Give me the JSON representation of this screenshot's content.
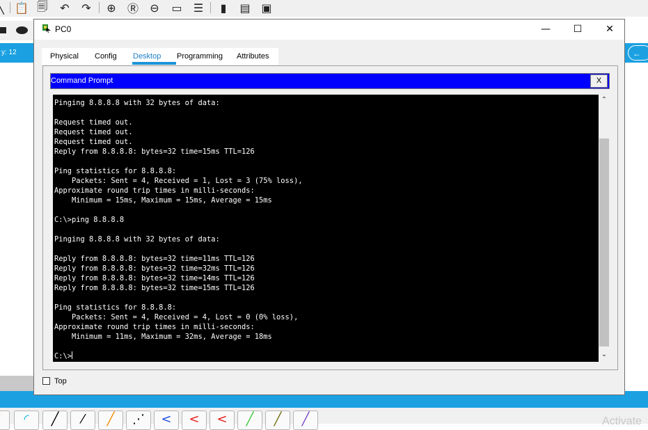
{
  "background_app": {
    "toolbar_icons": [
      "pointer-icon",
      "paste-icon",
      "copy-icon",
      "undo-icon",
      "redo-icon",
      "zoom-in-icon",
      "zoom-reset-icon",
      "zoom-out-icon",
      "rectangle-icon",
      "list-icon",
      "notes-icon",
      "drawing-palette-icon",
      "image-icon"
    ],
    "left_strip_text": "y: 12",
    "right_strip_text": "←",
    "device_palette_icons": [
      "bolt-icon",
      "curve-icon",
      "straight-line-icon",
      "dashed-line-icon",
      "orange-line-icon",
      "dotted-line-icon",
      "blue-angle-icon",
      "red-angle-icon",
      "red-angle2-icon",
      "green-line-icon",
      "olive-line-icon",
      "purple-line-icon"
    ],
    "watermark_text": "Activate"
  },
  "window": {
    "title": "PC0",
    "minimize": "—",
    "maximize": "☐",
    "close": "✕",
    "tabs": [
      {
        "label": "Physical",
        "active": false
      },
      {
        "label": "Config",
        "active": false
      },
      {
        "label": "Desktop",
        "active": true
      },
      {
        "label": "Programming",
        "active": false
      },
      {
        "label": "Attributes",
        "active": false
      }
    ],
    "command_prompt": {
      "title": "Command Prompt",
      "close_label": "X",
      "output": "Pinging 8.8.8.8 with 32 bytes of data:\n\nRequest timed out.\nRequest timed out.\nRequest timed out.\nReply from 8.8.8.8: bytes=32 time=15ms TTL=126\n\nPing statistics for 8.8.8.8:\n    Packets: Sent = 4, Received = 1, Lost = 3 (75% loss),\nApproximate round trip times in milli-seconds:\n    Minimum = 15ms, Maximum = 15ms, Average = 15ms\n\nC:\\>ping 8.8.8.8\n\nPinging 8.8.8.8 with 32 bytes of data:\n\nReply from 8.8.8.8: bytes=32 time=11ms TTL=126\nReply from 8.8.8.8: bytes=32 time=32ms TTL=126\nReply from 8.8.8.8: bytes=32 time=14ms TTL=126\nReply from 8.8.8.8: bytes=32 time=15ms TTL=126\n\nPing statistics for 8.8.8.8:\n    Packets: Sent = 4, Received = 4, Lost = 0 (0% loss),\nApproximate round trip times in milli-seconds:\n    Minimum = 11ms, Maximum = 32ms, Average = 18ms\n\n",
      "prompt": "C:\\>"
    },
    "top_checkbox": {
      "label": "Top",
      "checked": false
    }
  },
  "colors": {
    "accent_blue": "#1ba1e2",
    "cmd_header": "#0000ff",
    "terminal_bg": "#000000",
    "terminal_fg": "#ffffff",
    "active_tab": "#1c7fc7"
  }
}
